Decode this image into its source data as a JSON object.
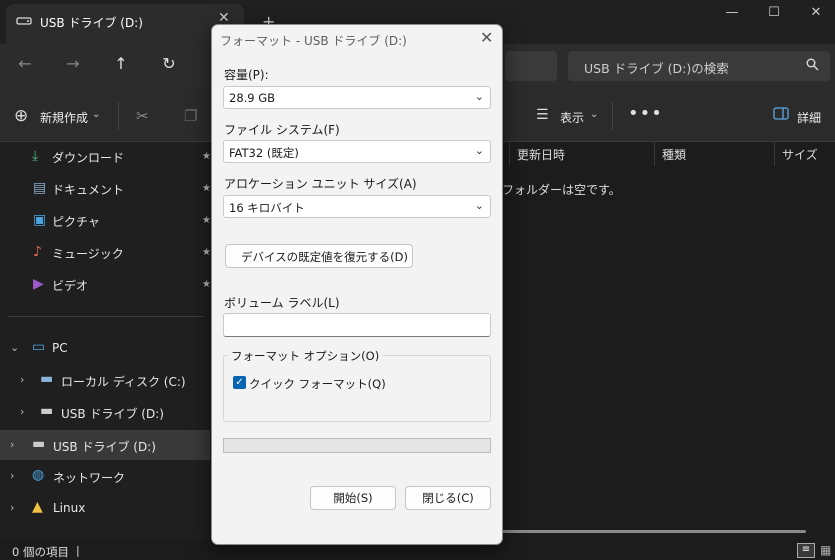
{
  "explorer": {
    "tab_title": "USB ドライブ (D:)",
    "search_placeholder": "USB ドライブ (D:)の検索",
    "toolbar": {
      "new_label": "新規作成",
      "view_label": "表示",
      "details_label": "詳細"
    },
    "sidebar": {
      "quick_access": [
        {
          "label": "ダウンロード",
          "icon": "download-icon",
          "color": "#4fb985"
        },
        {
          "label": "ドキュメント",
          "icon": "document-icon",
          "color": "#8aa6c8"
        },
        {
          "label": "ピクチャ",
          "icon": "picture-icon",
          "color": "#4aa3e0"
        },
        {
          "label": "ミュージック",
          "icon": "music-icon",
          "color": "#e0684f"
        },
        {
          "label": "ビデオ",
          "icon": "video-icon",
          "color": "#9b59c9"
        }
      ],
      "tree": {
        "pc": "PC",
        "local_disk": "ローカル ディスク (C:)",
        "usb_drive_child": "USB ドライブ (D:)",
        "usb_drive": "USB ドライブ (D:)",
        "network": "ネットワーク",
        "linux": "Linux"
      }
    },
    "columns": [
      "更新日時",
      "種類",
      "サイズ"
    ],
    "empty_message": "フォルダーは空です。",
    "status_text": "0 個の項目"
  },
  "format_dialog": {
    "title": "フォーマット - USB ドライブ (D:)",
    "capacity_label": "容量(P):",
    "capacity_value": "28.9 GB",
    "filesystem_label": "ファイル システム(F)",
    "filesystem_value": "FAT32 (既定)",
    "allocation_label": "アロケーション ユニット サイズ(A)",
    "allocation_value": "16 キロバイト",
    "restore_label": "デバイスの既定値を復元する(D)",
    "volume_label": "ボリューム ラベル(L)",
    "volume_value": "",
    "options_legend": "フォーマット オプション(O)",
    "quick_format_label": "クイック フォーマット(Q)",
    "quick_format_checked": true,
    "progress": 0,
    "start_label": "開始(S)",
    "close_label": "閉じる(C)"
  }
}
